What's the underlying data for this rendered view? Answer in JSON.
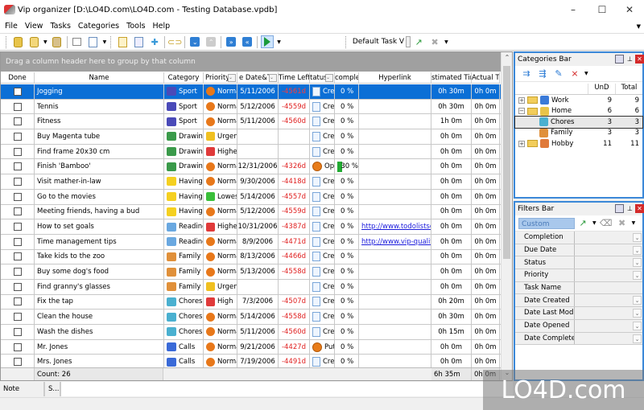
{
  "window": {
    "title": "Vip organizer [D:\\LO4D.com\\LO4D.com - Testing Database.vpdb]",
    "minimize": "–",
    "maximize": "☐",
    "close": "✕"
  },
  "menu": [
    "File",
    "View",
    "Tasks",
    "Categories",
    "Tools",
    "Help"
  ],
  "toolbar": {
    "icons": [
      "open-database-icon",
      "new-database-icon",
      "save-database-icon",
      "print-icon",
      "print-preview-icon",
      "new-task-icon",
      "edit-task-icon",
      "delete-task-icon",
      "link-icon",
      "move-down-icon",
      "move-up-icon",
      "move-bottom-icon",
      "move-top-icon",
      "view-flag-icon"
    ],
    "view_name": "Default Task V",
    "view_arrows": "v"
  },
  "grid": {
    "group_hint": "Drag a column header here to group by that column",
    "columns": [
      "Done",
      "Name",
      "Category",
      "Priority",
      "Due Date&Time",
      "Time Left",
      "Status",
      "Complete",
      "Hyperlink",
      "Estimated Time",
      "Actual Time"
    ],
    "columns_shown": [
      "Done",
      "Name",
      "Category",
      "Priority",
      "e Date&Ti",
      "Time Left",
      "tatus",
      "complete",
      "Hyperlink",
      "stimated Tim",
      "Actual Ti"
    ],
    "rows": [
      {
        "done": false,
        "name": "Jogging",
        "category": "Sport",
        "cat_icon": "flag",
        "priority": "Normal",
        "pri_icon": "normal",
        "due": "5/11/2006",
        "left": "-4561d",
        "status": "Created",
        "status_icon": "created",
        "complete": "0 %",
        "link": "",
        "est": "0h 30m",
        "act": "0h 0m",
        "selected": true
      },
      {
        "done": false,
        "name": "Tennis",
        "category": "Sport",
        "cat_icon": "flag",
        "priority": "Normal",
        "pri_icon": "normal",
        "due": "5/12/2006",
        "left": "-4559d",
        "status": "Created",
        "status_icon": "created",
        "complete": "0 %",
        "link": "",
        "est": "0h 30m",
        "act": "0h 0m"
      },
      {
        "done": false,
        "name": "Fitness",
        "category": "Sport",
        "cat_icon": "flag",
        "priority": "Normal",
        "pri_icon": "normal",
        "due": "5/11/2006",
        "left": "-4560d",
        "status": "Created",
        "status_icon": "created",
        "complete": "0 %",
        "link": "",
        "est": "1h 0m",
        "act": "0h 0m"
      },
      {
        "done": false,
        "name": "Buy Magenta tube",
        "category": "Drawing",
        "cat_icon": "drawing",
        "priority": "Urgent",
        "pri_icon": "urgent",
        "due": "",
        "left": "",
        "status": "Created",
        "status_icon": "created",
        "complete": "0 %",
        "link": "",
        "est": "0h 0m",
        "act": "0h 0m"
      },
      {
        "done": false,
        "name": "Find frame 20x30 cm",
        "category": "Drawing",
        "cat_icon": "drawing",
        "priority": "Highest",
        "pri_icon": "highest",
        "due": "",
        "left": "",
        "status": "Created",
        "status_icon": "created",
        "complete": "0 %",
        "link": "",
        "est": "0h 0m",
        "act": "0h 0m"
      },
      {
        "done": false,
        "name": "Finish 'Bamboo'",
        "category": "Drawing",
        "cat_icon": "drawing",
        "priority": "Normal",
        "pri_icon": "normal",
        "due": "12/31/2006",
        "left": "-4326d",
        "status": "Opened",
        "status_icon": "open",
        "complete": "30 %",
        "complete_fraction": 0.3,
        "link": "",
        "est": "0h 0m",
        "act": "0h 0m"
      },
      {
        "done": false,
        "name": "Visit mather-in-law",
        "category": "Having Fun",
        "cat_icon": "smile",
        "priority": "Normal",
        "pri_icon": "normal",
        "due": "9/30/2006",
        "left": "-4418d",
        "status": "Created",
        "status_icon": "created",
        "complete": "0 %",
        "link": "",
        "est": "0h 0m",
        "act": "0h 0m"
      },
      {
        "done": false,
        "name": "Go to the movies",
        "category": "Having Fun",
        "cat_icon": "smile",
        "priority": "Lowest",
        "pri_icon": "lowest",
        "due": "5/14/2006",
        "left": "-4557d",
        "status": "Created",
        "status_icon": "created",
        "complete": "0 %",
        "link": "",
        "est": "0h 0m",
        "act": "0h 0m"
      },
      {
        "done": false,
        "name": "Meeting friends, having a bud",
        "category": "Having Fun",
        "cat_icon": "smile",
        "priority": "Normal",
        "pri_icon": "normal",
        "due": "5/12/2006",
        "left": "-4559d",
        "status": "Created",
        "status_icon": "created",
        "complete": "0 %",
        "link": "",
        "est": "0h 0m",
        "act": "0h 0m"
      },
      {
        "done": false,
        "name": "How to set goals",
        "category": "Reading",
        "cat_icon": "reading",
        "priority": "Highest",
        "pri_icon": "highest",
        "due": "10/31/2006",
        "left": "-4387d",
        "status": "Created",
        "status_icon": "created",
        "complete": "0 %",
        "link": "http://www.todolistsoft",
        "est": "0h 0m",
        "act": "0h 0m"
      },
      {
        "done": false,
        "name": "Time management tips",
        "category": "Reading",
        "cat_icon": "reading",
        "priority": "Normal",
        "pri_icon": "normal",
        "due": "8/9/2006",
        "left": "-4471d",
        "status": "Created",
        "status_icon": "created",
        "complete": "0 %",
        "link": "http://www.vip-qualitys",
        "est": "0h 0m",
        "act": "0h 0m"
      },
      {
        "done": false,
        "name": "Take kids to the zoo",
        "category": "Family",
        "cat_icon": "family",
        "priority": "Normal",
        "pri_icon": "normal",
        "due": "8/13/2006",
        "left": "-4466d",
        "status": "Created",
        "status_icon": "created",
        "complete": "0 %",
        "link": "",
        "est": "0h 0m",
        "act": "0h 0m"
      },
      {
        "done": false,
        "name": "Buy some dog's food",
        "category": "Family",
        "cat_icon": "family",
        "priority": "Normal",
        "pri_icon": "normal",
        "due": "5/13/2006",
        "left": "-4558d",
        "status": "Created",
        "status_icon": "created",
        "complete": "0 %",
        "link": "",
        "est": "0h 0m",
        "act": "0h 0m"
      },
      {
        "done": false,
        "name": "Find granny's glasses",
        "category": "Family",
        "cat_icon": "family",
        "priority": "Urgent",
        "pri_icon": "urgent",
        "due": "",
        "left": "",
        "status": "Created",
        "status_icon": "created",
        "complete": "0 %",
        "link": "",
        "est": "0h 0m",
        "act": "0h 0m"
      },
      {
        "done": false,
        "name": "Fix the tap",
        "category": "Chores",
        "cat_icon": "chores",
        "priority": "High",
        "pri_icon": "high",
        "due": "7/3/2006",
        "left": "-4507d",
        "status": "Created",
        "status_icon": "created",
        "complete": "0 %",
        "link": "",
        "est": "0h 20m",
        "act": "0h 0m"
      },
      {
        "done": false,
        "name": "Clean the house",
        "category": "Chores",
        "cat_icon": "chores",
        "priority": "Normal",
        "pri_icon": "normal",
        "due": "5/14/2006",
        "left": "-4558d",
        "status": "Created",
        "status_icon": "created",
        "complete": "0 %",
        "link": "",
        "est": "0h 30m",
        "act": "0h 0m"
      },
      {
        "done": false,
        "name": "Wash the dishes",
        "category": "Chores",
        "cat_icon": "chores",
        "priority": "Normal",
        "pri_icon": "normal",
        "due": "5/11/2006",
        "left": "-4560d",
        "status": "Created",
        "status_icon": "created",
        "complete": "0 %",
        "link": "",
        "est": "0h 15m",
        "act": "0h 0m"
      },
      {
        "done": false,
        "name": "Mr. Jones",
        "category": "Calls",
        "cat_icon": "calls",
        "priority": "Normal",
        "pri_icon": "normal",
        "due": "9/21/2006",
        "left": "-4427d",
        "status": "Put off",
        "status_icon": "put",
        "complete": "0 %",
        "link": "",
        "est": "0h 0m",
        "act": "0h 0m"
      },
      {
        "done": false,
        "name": "Mrs. Jones",
        "category": "Calls",
        "cat_icon": "calls",
        "priority": "Normal",
        "pri_icon": "normal",
        "due": "7/19/2006",
        "left": "-4491d",
        "status": "Created",
        "status_icon": "created",
        "complete": "0 %",
        "link": "",
        "est": "0h 0m",
        "act": "0h 0m"
      }
    ],
    "footer": {
      "count": "Count: 26",
      "est_total": "6h 35m",
      "act_total": "0h 0m"
    }
  },
  "bottom_tabs": [
    "Note",
    "S..."
  ],
  "categories_bar": {
    "title": "Categories Bar",
    "columns": [
      "UnD",
      "Total"
    ],
    "items": [
      {
        "name": "Work",
        "und": "9",
        "total": "9",
        "level": 0,
        "expander": "+",
        "icon": "computer"
      },
      {
        "name": "Home",
        "und": "6",
        "total": "6",
        "level": 0,
        "expander": "−",
        "icon": "key"
      },
      {
        "name": "Chores",
        "und": "3",
        "total": "3",
        "level": 1,
        "expander": "",
        "icon": "chores",
        "selected": true
      },
      {
        "name": "Family",
        "und": "3",
        "total": "3",
        "level": 1,
        "expander": "",
        "icon": "family"
      },
      {
        "name": "Hobby",
        "und": "11",
        "total": "11",
        "level": 0,
        "expander": "+",
        "icon": "palette"
      }
    ]
  },
  "filters_bar": {
    "title": "Filters Bar",
    "preset": "Custom",
    "fields": [
      {
        "label": "Completion",
        "dropdown": true
      },
      {
        "label": "Due Date",
        "dropdown": true
      },
      {
        "label": "Status",
        "dropdown": true
      },
      {
        "label": "Priority",
        "dropdown": true
      },
      {
        "label": "Task Name",
        "dropdown": false
      },
      {
        "label": "Date Created",
        "dropdown": true
      },
      {
        "label": "Date Last Modified",
        "dropdown": true
      },
      {
        "label": "Date Opened",
        "dropdown": true
      },
      {
        "label": "Date Completed",
        "dropdown": true
      }
    ]
  },
  "watermark": "LO4D.com",
  "colors": {
    "selection": "#0b6fd6",
    "negative": "#e02020",
    "link": "#1a1adb",
    "panel_border": "#3b88d8",
    "progress": "#22aa33"
  }
}
